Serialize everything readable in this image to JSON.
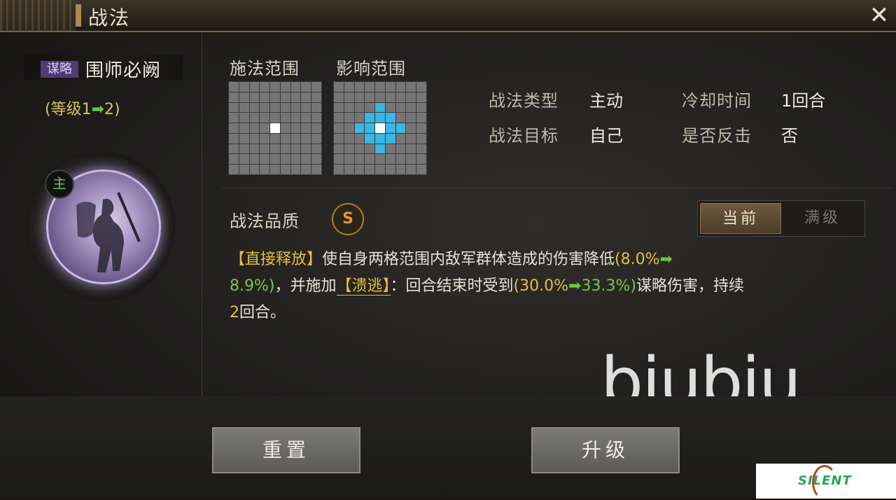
{
  "window": {
    "title": "战法",
    "close_icon": "close-icon"
  },
  "skill": {
    "type_tag": "谋略",
    "name": "围师必阙",
    "level_prefix": "(等级1",
    "level_arrow": "➡",
    "level_suffix": "2)",
    "role_badge": "主"
  },
  "ranges": {
    "cast_label": "施法范围",
    "effect_label": "影响范围"
  },
  "info": {
    "type_label": "战法类型",
    "type_value": "主动",
    "target_label": "战法目标",
    "target_value": "自己",
    "cooldown_label": "冷却时间",
    "cooldown_value": "1回合",
    "counter_label": "是否反击",
    "counter_value": "否"
  },
  "quality": {
    "label": "战法品质",
    "grade": "S"
  },
  "toggle": {
    "current": "当前",
    "max": "满级"
  },
  "description": {
    "tag": "【直接释放】",
    "text1": "使自身两格范围内敌军群体造成的伤害降低",
    "v1_from": "(8.0%",
    "v1_to": "8.9%)",
    "text2": "，并施加",
    "effect": "【溃逃】",
    "text3": "：回合结束时受到",
    "v2_from": "(30.0%",
    "v2_to": "33.3%)",
    "text4": "谋略伤害，持续",
    "duration": "2",
    "text5": "回合。"
  },
  "buttons": {
    "reset": "重置",
    "upgrade": "升级"
  },
  "watermark": "biubiu",
  "logo": "SILENT",
  "colors": {
    "highlight_yellow": "#e5bf3c",
    "highlight_green": "#78c845",
    "range_blue": "#39b6e3"
  }
}
